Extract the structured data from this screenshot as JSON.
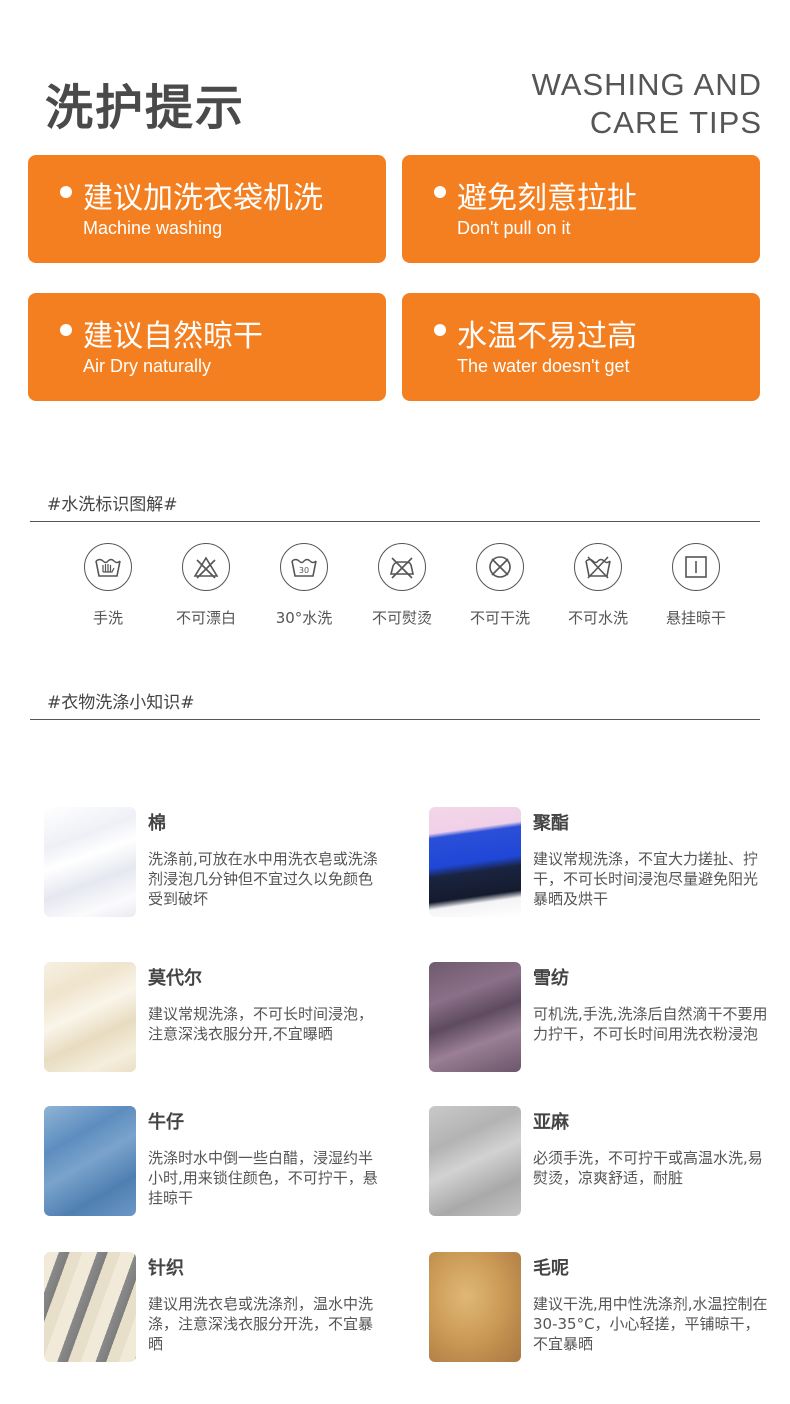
{
  "header": {
    "title_cn": "洗护提示",
    "title_en_line1": "WASHING AND",
    "title_en_line2": "CARE TIPS"
  },
  "tips": [
    {
      "cn": "建议加洗衣袋机洗",
      "en": "Machine washing"
    },
    {
      "cn": "避免刻意拉扯",
      "en": "Don't pull on it"
    },
    {
      "cn": "建议自然晾干",
      "en": "Air Dry naturally"
    },
    {
      "cn": "水温不易过高",
      "en": "The water doesn't get"
    }
  ],
  "symbols_section": {
    "title": "#水洗标识图解#",
    "items": [
      {
        "label": "手洗",
        "icon": "hand-wash-icon"
      },
      {
        "label": "不可漂白",
        "icon": "no-bleach-icon"
      },
      {
        "label": "30°水洗",
        "icon": "wash-30-icon"
      },
      {
        "label": "不可熨烫",
        "icon": "no-iron-icon"
      },
      {
        "label": "不可干洗",
        "icon": "no-dry-clean-icon"
      },
      {
        "label": "不可水洗",
        "icon": "no-wash-icon"
      },
      {
        "label": "悬挂晾干",
        "icon": "line-dry-icon"
      }
    ],
    "icon_text_30": "30"
  },
  "knowledge_section": {
    "title": "#衣物洗涤小知识#",
    "fabrics": [
      {
        "name": "棉",
        "desc": "洗涤前,可放在水中用洗衣皂或洗涤剂浸泡几分钟但不宜过久以免颜色受到破坏"
      },
      {
        "name": "聚酯",
        "desc": "建议常规洗涤，不宜大力搓扯、拧干，不可长时间浸泡尽量避免阳光暴晒及烘干"
      },
      {
        "name": "莫代尔",
        "desc": "建议常规洗涤，不可长时间浸泡，注意深浅衣服分开,不宜曝晒"
      },
      {
        "name": "雪纺",
        "desc": "可机洗,手洗,洗涤后自然滴干不要用力拧干，不可长时间用洗衣粉浸泡"
      },
      {
        "name": "牛仔",
        "desc": "洗涤时水中倒一些白醋，浸湿约半小时,用来锁住颜色，不可拧干，悬挂晾干"
      },
      {
        "name": "亚麻",
        "desc": "必须手洗，不可拧干或高温水洗,易熨烫，凉爽舒适，耐脏"
      },
      {
        "name": "针织",
        "desc": "建议用洗衣皂或洗涤剂，温水中洗涤，注意深浅衣服分开洗，不宜暴晒"
      },
      {
        "name": "毛呢",
        "desc": "建议干洗,用中性洗涤剂,水温控制在30-35°C，小心轻搓，平铺晾干，不宜暴晒"
      }
    ]
  },
  "colors": {
    "accent": "#f47f20",
    "text": "#555555"
  }
}
